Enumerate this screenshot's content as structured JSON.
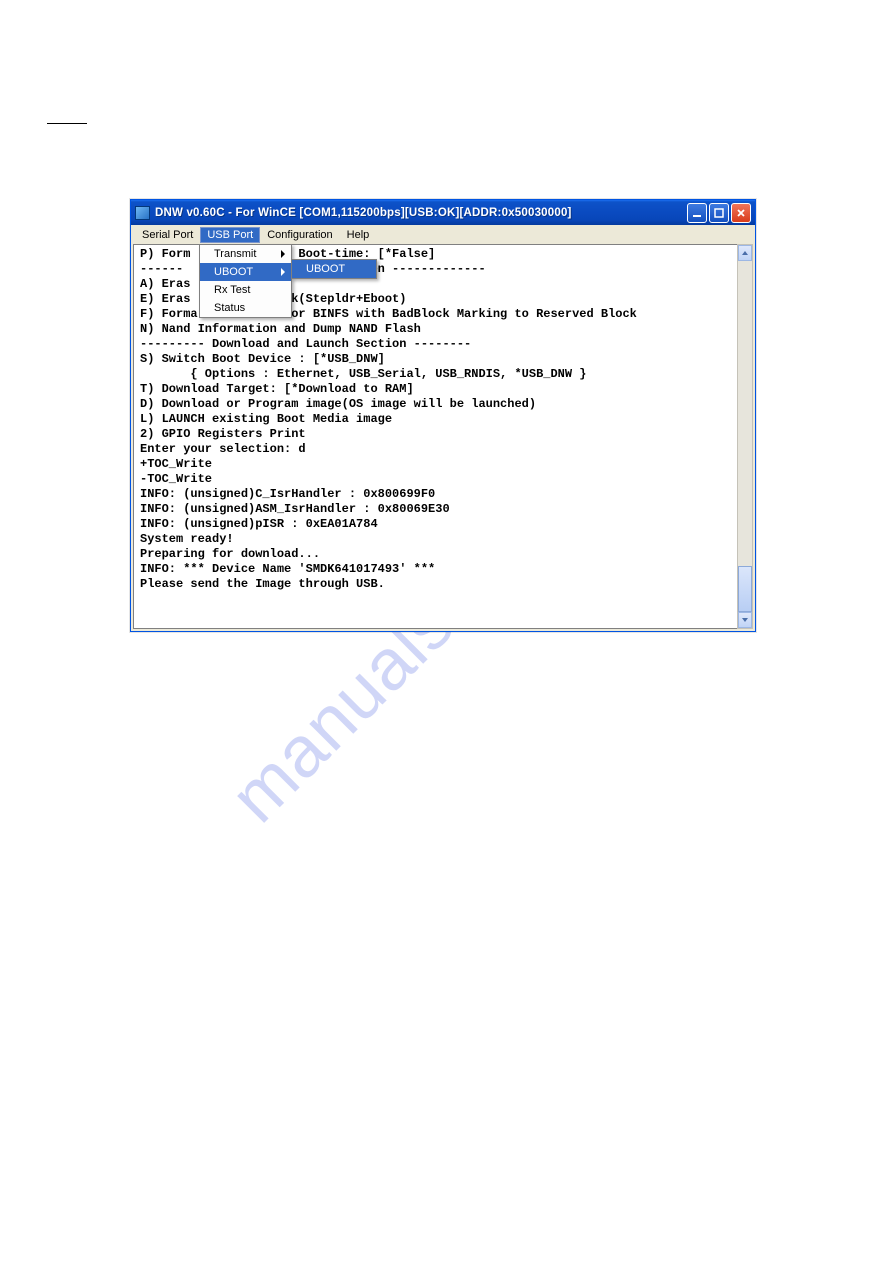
{
  "watermark": "manualshive.com",
  "titlebar": {
    "text": "DNW v0.60C - For WinCE   [COM1,115200bps][USB:OK][ADDR:0x50030000]"
  },
  "menubar": {
    "items": [
      {
        "label": "Serial Port"
      },
      {
        "label": "USB Port"
      },
      {
        "label": "Configuration"
      },
      {
        "label": "Help"
      }
    ],
    "active_index": 1
  },
  "dropdown": {
    "items": [
      {
        "label": "Transmit",
        "has_sub": true,
        "highlight": false
      },
      {
        "label": "UBOOT",
        "has_sub": true,
        "highlight": true
      },
      {
        "label": "Rx Test",
        "has_sub": false,
        "highlight": false
      },
      {
        "label": "Status",
        "has_sub": false,
        "highlight": false
      }
    ]
  },
  "submenu": {
    "items": [
      {
        "label": "UBOOT",
        "highlight": true
      }
    ]
  },
  "console_lines": [
    "P) Form          m on Boot-time: [*False]",
    "------           ----------- ction -------------",
    "A) Eras",
    "E) Eras          Block(Stepldr+Eboot)",
    "F) Forma         ia for BINFS with BadBlock Marking to Reserved Block",
    "N) Nand Information and Dump NAND Flash",
    "--------- Download and Launch Section --------",
    "S) Switch Boot Device : [*USB_DNW]",
    "       { Options : Ethernet, USB_Serial, USB_RNDIS, *USB_DNW }",
    "T) Download Target: [*Download to RAM]",
    "D) Download or Program image(OS image will be launched)",
    "L) LAUNCH existing Boot Media image",
    "2) GPIO Registers Print",
    "Enter your selection: d",
    "+TOC_Write",
    "-TOC_Write",
    "INFO: (unsigned)C_IsrHandler : 0x800699F0",
    "INFO: (unsigned)ASM_IsrHandler : 0x80069E30",
    "INFO: (unsigned)pISR : 0xEA01A784",
    "System ready!",
    "Preparing for download...",
    "INFO: *** Device Name 'SMDK641017493' ***",
    "Please send the Image through USB."
  ]
}
